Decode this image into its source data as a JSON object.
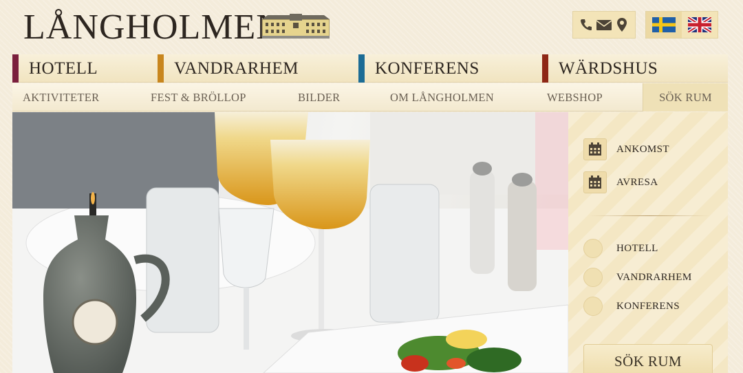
{
  "header": {
    "logo": "LÅNGHOLMEN",
    "contact_icons": [
      "phone-icon",
      "envelope-icon",
      "map-pin-icon"
    ],
    "languages": [
      {
        "code": "sv",
        "icon": "swedish-flag-icon",
        "active": true
      },
      {
        "code": "en",
        "icon": "uk-flag-icon",
        "active": false
      }
    ]
  },
  "main_nav": [
    {
      "label": "HOTELL",
      "color": "#7a1f3d"
    },
    {
      "label": "VANDRARHEM",
      "color": "#c8861e"
    },
    {
      "label": "KONFERENS",
      "color": "#1c6c95"
    },
    {
      "label": "WÄRDSHUS",
      "color": "#8e2716"
    }
  ],
  "sub_nav": {
    "items": [
      "AKTIVITETER",
      "FEST & BRÖLLOP",
      "BILDER",
      "OM LÅNGHOLMEN",
      "WEBSHOP"
    ],
    "active": "SÖK RUM"
  },
  "booking": {
    "arrival_label": "ANKOMST",
    "departure_label": "AVRESA",
    "options": [
      "HOTELL",
      "VANDRARHEM",
      "KONFERENS"
    ],
    "button_label": "SÖK RUM"
  },
  "hero": {
    "image": "restaurant-table-photo"
  }
}
